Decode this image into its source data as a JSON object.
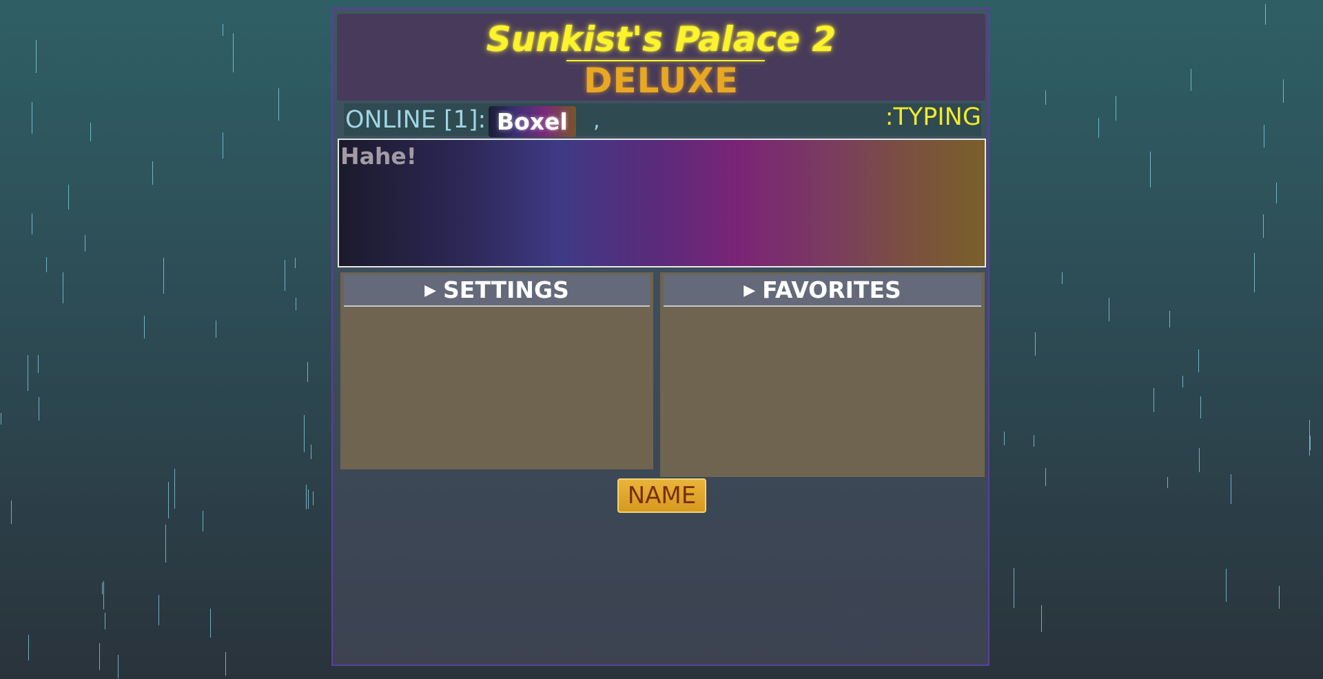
{
  "header": {
    "title": "Sunkist's Palace 2",
    "subtitle": "DELUXE"
  },
  "online_bar": {
    "online_label": "ONLINE [1]:",
    "users": [
      {
        "name": "Boxel"
      }
    ],
    "separator": ",",
    "typing_label": ":TYPING"
  },
  "chat": {
    "message": "Hahe!"
  },
  "settings": {
    "arrow": "▶",
    "label": "SETTINGS"
  },
  "favorites": {
    "arrow": "▶",
    "label": "FAVORITES"
  },
  "name_button": {
    "label": "NAME"
  },
  "colors": {
    "title": "#fbf32b",
    "subtitle": "#e8a824",
    "online_text": "#9fd5e4",
    "typing_text": "#f2ea2b",
    "panel_border": "#5b3f9e",
    "box_fill": "#6e6450",
    "button_fill": "#e9b43a"
  }
}
